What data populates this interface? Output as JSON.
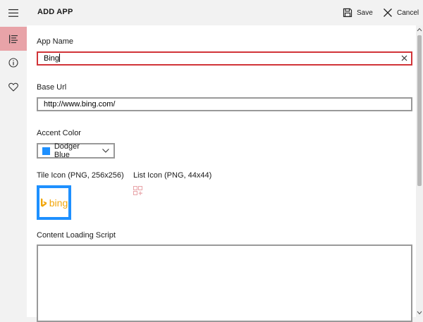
{
  "app": {
    "title": "ADD APP"
  },
  "commands": {
    "save": "Save",
    "cancel": "Cancel"
  },
  "sidebar": {
    "items": [
      {
        "name": "list",
        "icon": "list-icon",
        "active": true
      },
      {
        "name": "info",
        "icon": "info-icon",
        "active": false
      },
      {
        "name": "favorites",
        "icon": "heart-icon",
        "active": false
      }
    ]
  },
  "form": {
    "app_name": {
      "label": "App Name",
      "value": "Bing"
    },
    "base_url": {
      "label": "Base Url",
      "value": "http://www.bing.com/"
    },
    "accent_color": {
      "label": "Accent Color",
      "value": "Dodger Blue",
      "color": "#1e90ff"
    },
    "tile_icon": {
      "label": "Tile Icon (PNG, 256x256)",
      "logo_text": "bing"
    },
    "list_icon": {
      "label": "List Icon (PNG, 44x44)"
    },
    "content_loading_script": {
      "label": "Content Loading Script",
      "value": ""
    }
  },
  "colors": {
    "accent": "#d13438",
    "active_nav": "#e8a3a8",
    "dodger_blue": "#1e90ff",
    "bing_orange": "#f2a60b"
  }
}
